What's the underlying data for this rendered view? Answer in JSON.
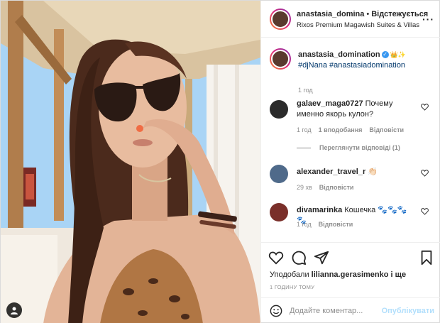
{
  "post": {
    "username": "anastasia_domina",
    "separator": "•",
    "follow_status": "Відстежується",
    "location": "Rixos Premium Magawish Suites & Villas",
    "more_icon": "more-horizontal-icon"
  },
  "caption": {
    "username": "anastasia_domination",
    "verified": true,
    "emoji": "👑✨",
    "tags": "#djNana #anastasiadomination",
    "time": "1 год"
  },
  "comments": [
    {
      "username": "galaev_maga0727",
      "text": "Почему именно якорь кулон?",
      "time": "1 год",
      "likes": "1 вподобання",
      "reply": "Відповісти",
      "view_replies": "Переглянути відповіді (1)"
    },
    {
      "username": "alexander_travel_r",
      "text": "👏🏻",
      "time": "29 хв",
      "reply": "Відповісти"
    },
    {
      "username": "divamarinka",
      "text": "Кошечка 🐾🐾🐾🐾",
      "time": "1 год",
      "reply": "Відповісти"
    }
  ],
  "actions": {
    "liked_by_prefix": "Уподобали",
    "liked_by_user": "lilianna.gerasimenko",
    "liked_by_suffix": "і ще",
    "post_time": "1 ГОДИНУ ТОМУ"
  },
  "add_comment": {
    "placeholder": "Додайте коментар...",
    "publish_label": "Опублікувати"
  },
  "colors": {
    "accent_link": "#00376b",
    "verified_blue": "#3897f0",
    "publish_disabled": "#b2dffc",
    "muted_text": "#8e8e8e"
  }
}
